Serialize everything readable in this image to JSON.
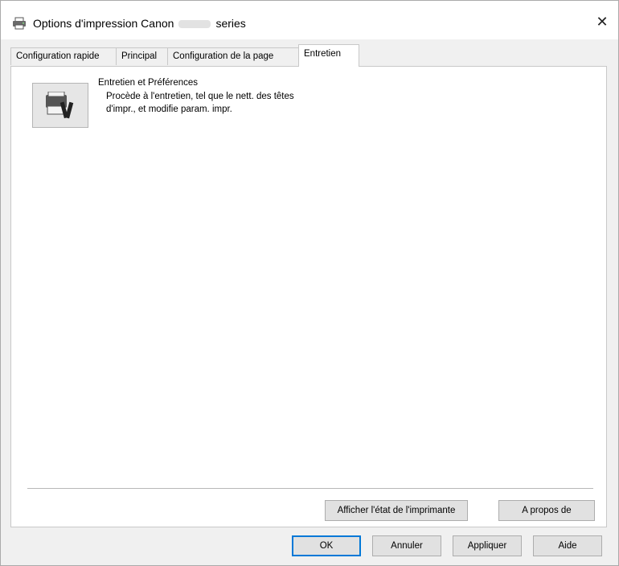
{
  "window": {
    "title_prefix": "Options d'impression Canon",
    "title_suffix": "series",
    "close_glyph": "✕"
  },
  "tabs": [
    {
      "label": "Configuration rapide"
    },
    {
      "label": "Principal"
    },
    {
      "label": "Configuration de la page"
    },
    {
      "label": "Entretien"
    }
  ],
  "maintenance": {
    "title": "Entretien et Préférences",
    "description": "Procède à l'entretien, tel que le nett. des têtes d'impr., et modifie param. impr.",
    "icon": "printer-maintenance-icon"
  },
  "panel_buttons": {
    "printer_status": "Afficher l'état de l'imprimante",
    "about": "A propos de"
  },
  "dialog_buttons": {
    "ok": "OK",
    "cancel": "Annuler",
    "apply": "Appliquer",
    "help": "Aide"
  },
  "colors": {
    "focus_border": "#0078d7",
    "dialog_bg": "#f0f0f0"
  }
}
